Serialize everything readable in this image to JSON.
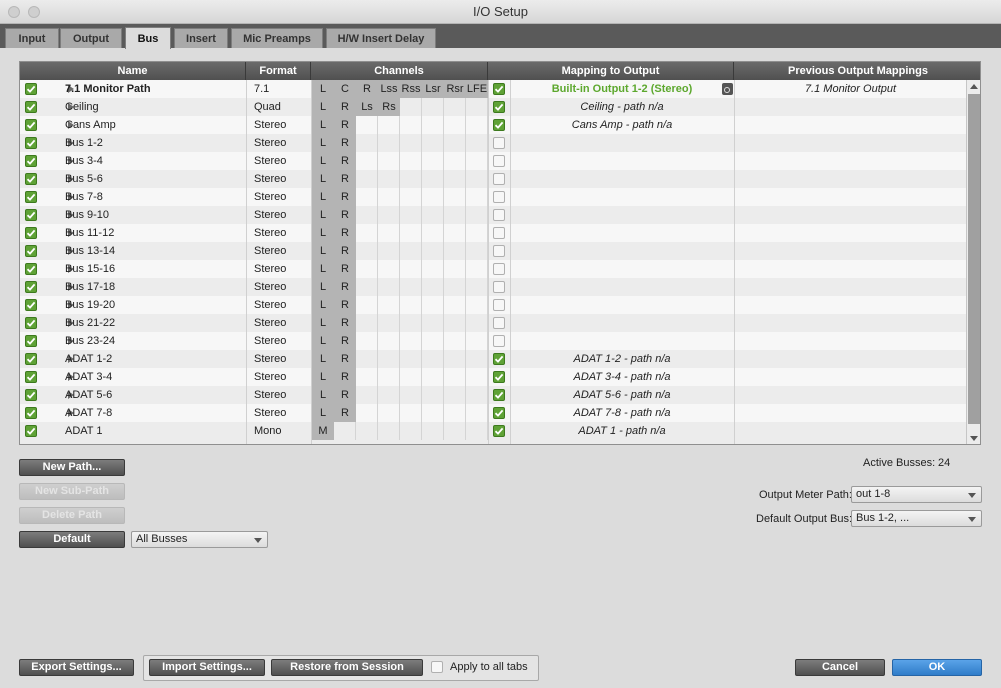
{
  "window": {
    "title": "I/O Setup"
  },
  "tabs": [
    {
      "label": "Input",
      "active": false
    },
    {
      "label": "Output",
      "active": false
    },
    {
      "label": "Bus",
      "active": true
    },
    {
      "label": "Insert",
      "active": false
    },
    {
      "label": "Mic Preamps",
      "active": false
    },
    {
      "label": "H/W Insert Delay",
      "active": false
    }
  ],
  "table": {
    "headers": {
      "name": "Name",
      "format": "Format",
      "channels": "Channels",
      "mapping": "Mapping to Output",
      "previous": "Previous Output Mappings"
    },
    "channel_labels": [
      "L",
      "C",
      "R",
      "Lss",
      "Rss",
      "Lsr",
      "Rsr",
      "LFE"
    ],
    "rows": [
      {
        "name": "7.1 Monitor Path",
        "bold": true,
        "checked": true,
        "expand": true,
        "format": "7.1",
        "channels": [
          "L",
          "C",
          "R",
          "Lss",
          "Rss",
          "Lsr",
          "Rsr",
          "LFE"
        ],
        "map_checked": true,
        "mapping": "Built-in Output 1-2 (Stereo)",
        "mapping_style": "green",
        "speaker": true,
        "previous": "7.1 Monitor Output"
      },
      {
        "name": "Ceiling",
        "checked": true,
        "expand": true,
        "format": "Quad",
        "channels": [
          "L",
          "R",
          "Ls",
          "Rs"
        ],
        "map_checked": true,
        "mapping": "Ceiling - path n/a",
        "previous": ""
      },
      {
        "name": "Cans Amp",
        "checked": true,
        "expand": true,
        "format": "Stereo",
        "channels": [
          "L",
          "R"
        ],
        "map_checked": true,
        "mapping": "Cans Amp - path n/a",
        "previous": ""
      },
      {
        "name": "Bus 1-2",
        "checked": true,
        "expand": true,
        "format": "Stereo",
        "channels": [
          "L",
          "R"
        ],
        "map_checked": false,
        "mapping": "",
        "previous": ""
      },
      {
        "name": "Bus 3-4",
        "checked": true,
        "expand": true,
        "format": "Stereo",
        "channels": [
          "L",
          "R"
        ],
        "map_checked": false,
        "mapping": "",
        "previous": ""
      },
      {
        "name": "Bus 5-6",
        "checked": true,
        "expand": true,
        "format": "Stereo",
        "channels": [
          "L",
          "R"
        ],
        "map_checked": false,
        "mapping": "",
        "previous": ""
      },
      {
        "name": "Bus 7-8",
        "checked": true,
        "expand": true,
        "format": "Stereo",
        "channels": [
          "L",
          "R"
        ],
        "map_checked": false,
        "mapping": "",
        "previous": ""
      },
      {
        "name": "Bus 9-10",
        "checked": true,
        "expand": true,
        "format": "Stereo",
        "channels": [
          "L",
          "R"
        ],
        "map_checked": false,
        "mapping": "",
        "previous": ""
      },
      {
        "name": "Bus 11-12",
        "checked": true,
        "expand": true,
        "format": "Stereo",
        "channels": [
          "L",
          "R"
        ],
        "map_checked": false,
        "mapping": "",
        "previous": ""
      },
      {
        "name": "Bus 13-14",
        "checked": true,
        "expand": true,
        "format": "Stereo",
        "channels": [
          "L",
          "R"
        ],
        "map_checked": false,
        "mapping": "",
        "previous": ""
      },
      {
        "name": "Bus 15-16",
        "checked": true,
        "expand": true,
        "format": "Stereo",
        "channels": [
          "L",
          "R"
        ],
        "map_checked": false,
        "mapping": "",
        "previous": ""
      },
      {
        "name": "Bus 17-18",
        "checked": true,
        "expand": true,
        "format": "Stereo",
        "channels": [
          "L",
          "R"
        ],
        "map_checked": false,
        "mapping": "",
        "previous": ""
      },
      {
        "name": "Bus 19-20",
        "checked": true,
        "expand": true,
        "format": "Stereo",
        "channels": [
          "L",
          "R"
        ],
        "map_checked": false,
        "mapping": "",
        "previous": ""
      },
      {
        "name": "Bus 21-22",
        "checked": true,
        "expand": true,
        "format": "Stereo",
        "channels": [
          "L",
          "R"
        ],
        "map_checked": false,
        "mapping": "",
        "previous": ""
      },
      {
        "name": "Bus 23-24",
        "checked": true,
        "expand": true,
        "format": "Stereo",
        "channels": [
          "L",
          "R"
        ],
        "map_checked": false,
        "mapping": "",
        "previous": ""
      },
      {
        "name": "ADAT 1-2",
        "checked": true,
        "expand": true,
        "format": "Stereo",
        "channels": [
          "L",
          "R"
        ],
        "map_checked": true,
        "mapping": "ADAT 1-2 - path n/a",
        "previous": ""
      },
      {
        "name": "ADAT 3-4",
        "checked": true,
        "expand": true,
        "format": "Stereo",
        "channels": [
          "L",
          "R"
        ],
        "map_checked": true,
        "mapping": "ADAT 3-4 - path n/a",
        "previous": ""
      },
      {
        "name": "ADAT 5-6",
        "checked": true,
        "expand": true,
        "format": "Stereo",
        "channels": [
          "L",
          "R"
        ],
        "map_checked": true,
        "mapping": "ADAT 5-6 - path n/a",
        "previous": ""
      },
      {
        "name": "ADAT 7-8",
        "checked": true,
        "expand": true,
        "format": "Stereo",
        "channels": [
          "L",
          "R"
        ],
        "map_checked": true,
        "mapping": "ADAT 7-8 - path n/a",
        "previous": ""
      },
      {
        "name": "ADAT 1",
        "checked": true,
        "expand": false,
        "format": "Mono",
        "channels": [
          "M"
        ],
        "map_checked": true,
        "mapping": "ADAT 1 - path n/a",
        "previous": ""
      }
    ]
  },
  "buttons": {
    "new_path": "New Path...",
    "new_sub_path": "New Sub-Path",
    "delete_path": "Delete Path",
    "default": "Default",
    "export": "Export Settings...",
    "import": "Import Settings...",
    "restore": "Restore from Session",
    "cancel": "Cancel",
    "ok": "OK"
  },
  "filter_select": "All Busses",
  "active_busses_label": "Active Busses:",
  "active_busses_value": "24",
  "output_meter_label": "Output Meter Path:",
  "output_meter_value": "out 1-8",
  "default_output_label": "Default Output Bus:",
  "default_output_value": "Bus 1-2, ...",
  "apply_all_label": "Apply to all tabs",
  "colors": {
    "accent_green": "#5fa236",
    "ok_blue": "#3a8ad8",
    "header_dark": "#5a5a5a"
  }
}
